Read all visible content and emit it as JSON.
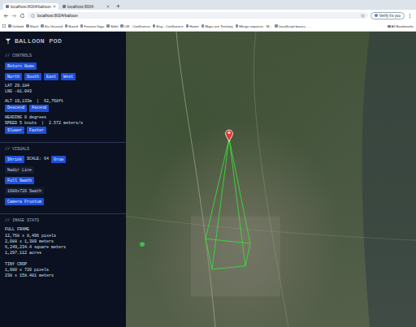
{
  "browser": {
    "tabs": [
      {
        "label": "localhost:8004/balloon",
        "selected": true
      },
      {
        "label": "localhost:8004",
        "selected": false
      }
    ],
    "address": "localhost:8004/balloon",
    "profile_button": "Verify it's you",
    "bookmarks": [
      "Outlook",
      "Slack",
      "Sis Unused",
      "Board",
      "Feature flags",
      "Stifel",
      "LIE - Confluence",
      "Eng - Confluence",
      "Home",
      "Maps are Territory",
      "Merge requests · M...",
      "JavaScript basics - ..."
    ],
    "all_bookmarks": "All Bookmarks"
  },
  "panel": {
    "title": "BALLOON POD",
    "controls": {
      "heading": "// CONTROLS",
      "return_button": "Return Home",
      "direction_buttons": [
        "North",
        "South",
        "East",
        "West"
      ],
      "lat": "LAT 29.184",
      "lng": "LNG -81.043",
      "alt": "ALT 19,133m  |  62,768ft",
      "altitude_buttons": [
        "Descend",
        "Ascend"
      ],
      "heading_reading": "HEADING 0 degrees",
      "speed": "SPEED 5 knots  |  2.572 meters/s",
      "speed_buttons": [
        "Slower",
        "Faster"
      ]
    },
    "visuals": {
      "heading": "// VISUALS",
      "shrink": "Shrink",
      "scale": "SCALE: 64",
      "grow": "Grow",
      "toggles": [
        {
          "label": "Nadir Line",
          "selected": false
        },
        {
          "label": "Full Swath",
          "selected": true
        },
        {
          "label": "1080x720 Swath",
          "selected": false
        },
        {
          "label": "Camera Frustum",
          "selected": true
        }
      ]
    },
    "stats": {
      "heading": "// IMAGE STATS",
      "groups": [
        {
          "title": "FULL FRAME",
          "lines": [
            "12,768 x 8,496 pixels",
            "2,088 x 1,389 meters",
            "6,249,234.4 square meters",
            "1,297.112 acres"
          ]
        },
        {
          "title": "TINY CROP",
          "lines": [
            "1,080 x 720 pixels",
            "238 x 158.481 meters"
          ]
        }
      ]
    }
  }
}
